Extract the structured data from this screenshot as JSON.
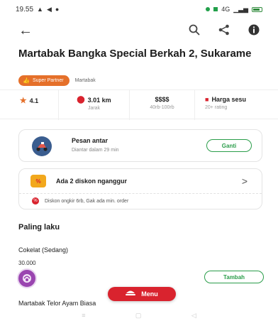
{
  "status_bar": {
    "time": "19.55",
    "signal_text": "Ⓢ",
    "network": "4G"
  },
  "restaurant": {
    "name": "Martabak Bangka Special Berkah 2, Sukarame",
    "badge": "Super Partner",
    "category": "Martabak"
  },
  "stats": [
    {
      "value": "4.1",
      "sub": "",
      "icon": "star-icon"
    },
    {
      "value": "3.01 km",
      "sub": "Jarak",
      "icon": "location-pin-icon"
    },
    {
      "value": "$$$$",
      "sub": "40rb-100rb",
      "icon": ""
    },
    {
      "value": "Harga sesu",
      "sub": "20+ rating",
      "icon": "shopping-bag-icon"
    }
  ],
  "delivery": {
    "title": "Pesan antar",
    "subtitle": "Diantar dalam 29 min",
    "button": "Ganti"
  },
  "discount": {
    "title": "Ada 2 diskon nganggur",
    "chevron": ">",
    "promo": "Diskon ongkir 6rb, Gak ada min. order"
  },
  "section": {
    "title": "Paling laku"
  },
  "items": [
    {
      "name": "Cokelat (Sedang)",
      "price": "30.000",
      "button": "Tambah"
    },
    {
      "name": "Martabak Telor Ayam Biasa"
    }
  ],
  "menu_button": "Menu",
  "colors": {
    "accent_green": "#2a9d4a",
    "brand_red": "#d9232e",
    "partner_orange": "#e5702a"
  }
}
